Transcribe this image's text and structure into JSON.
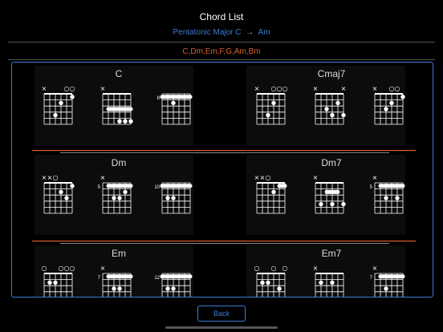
{
  "header": {
    "title": "Chord List",
    "key": "Pentatonic Major C",
    "arrow": "→",
    "relative": "Am"
  },
  "chord_list": "C,Dm,Em,F,G,Am,Bm",
  "back_label": "Back",
  "colors": {
    "accent": "#3a7bd5",
    "orange": "#d9622b",
    "grid": "#ffffff"
  },
  "groups": [
    {
      "label": "C",
      "diagrams": [
        {
          "open": [
            "x",
            "",
            "",
            "",
            "o",
            "o"
          ],
          "dots": [
            [
              2,
              4
            ],
            [
              3,
              2
            ],
            [
              5,
              1
            ]
          ],
          "barre": null,
          "fret": null
        },
        {
          "open": [
            "x",
            "",
            "",
            "",
            "",
            ""
          ],
          "dots": [
            [
              3,
              5
            ],
            [
              4,
              5
            ],
            [
              5,
              5
            ]
          ],
          "barre": [
            1,
            5,
            3
          ],
          "fret": null
        },
        {
          "open": [
            "",
            "",
            "",
            "",
            "",
            ""
          ],
          "dots": [
            [
              2,
              2
            ]
          ],
          "barre": [
            0,
            5,
            1
          ],
          "fret": "8"
        }
      ]
    },
    {
      "label": "Cmaj7",
      "diagrams": [
        {
          "open": [
            "x",
            "",
            "",
            "o",
            "o",
            "o"
          ],
          "dots": [
            [
              2,
              4
            ],
            [
              3,
              2
            ]
          ],
          "barre": null,
          "fret": null
        },
        {
          "open": [
            "x",
            "",
            "",
            "",
            "",
            "x"
          ],
          "dots": [
            [
              2,
              3
            ],
            [
              3,
              4
            ],
            [
              4,
              2
            ],
            [
              5,
              4
            ]
          ],
          "barre": null,
          "fret": null
        },
        {
          "open": [
            "x",
            "",
            "",
            "o",
            "o",
            ""
          ],
          "dots": [
            [
              2,
              3
            ],
            [
              3,
              2
            ],
            [
              5,
              1
            ]
          ],
          "barre": null,
          "fret": null
        }
      ]
    },
    {
      "label": "Dm",
      "diagrams": [
        {
          "open": [
            "x",
            "x",
            "o",
            "",
            "",
            ""
          ],
          "dots": [
            [
              4,
              3
            ],
            [
              5,
              1
            ],
            [
              3,
              2
            ]
          ],
          "barre": null,
          "fret": null
        },
        {
          "open": [
            "x",
            "",
            "",
            "",
            "",
            ""
          ],
          "dots": [
            [
              2,
              3
            ],
            [
              3,
              3
            ],
            [
              4,
              2
            ]
          ],
          "barre": [
            1,
            5,
            1
          ],
          "fret": "5"
        },
        {
          "open": [
            "",
            "",
            "",
            "",
            "",
            ""
          ],
          "dots": [
            [
              1,
              3
            ],
            [
              2,
              3
            ]
          ],
          "barre": [
            0,
            5,
            1
          ],
          "fret": "10"
        }
      ]
    },
    {
      "label": "Dm7",
      "diagrams": [
        {
          "open": [
            "x",
            "x",
            "o",
            "",
            "",
            ""
          ],
          "dots": [
            [
              3,
              2
            ]
          ],
          "barre": [
            4,
            5,
            1
          ],
          "fret": null
        },
        {
          "open": [
            "x",
            "",
            "",
            "",
            "",
            ""
          ],
          "dots": [
            [
              1,
              4
            ],
            [
              3,
              4
            ],
            [
              5,
              4
            ]
          ],
          "barre": [
            2,
            4,
            2
          ],
          "fret": null
        },
        {
          "open": [
            "x",
            "",
            "",
            "",
            "",
            ""
          ],
          "dots": [
            [
              2,
              3
            ],
            [
              4,
              3
            ]
          ],
          "barre": [
            1,
            5,
            1
          ],
          "fret": "5"
        }
      ]
    },
    {
      "label": "Em",
      "diagrams": [
        {
          "open": [
            "o",
            "",
            "",
            "o",
            "o",
            "o"
          ],
          "dots": [
            [
              1,
              2
            ],
            [
              2,
              2
            ]
          ],
          "barre": null,
          "fret": null
        },
        {
          "open": [
            "x",
            "",
            "",
            "",
            "",
            ""
          ],
          "dots": [
            [
              2,
              3
            ],
            [
              3,
              3
            ]
          ],
          "barre": [
            1,
            5,
            1
          ],
          "fret": "7"
        },
        {
          "open": [
            "",
            "",
            "",
            "",
            "",
            ""
          ],
          "dots": [
            [
              1,
              3
            ],
            [
              2,
              3
            ]
          ],
          "barre": [
            0,
            5,
            1
          ],
          "fret": "12"
        }
      ]
    },
    {
      "label": "Em7",
      "diagrams": [
        {
          "open": [
            "o",
            "",
            "",
            "o",
            "",
            "o"
          ],
          "dots": [
            [
              1,
              2
            ],
            [
              2,
              2
            ],
            [
              4,
              3
            ]
          ],
          "barre": null,
          "fret": null
        },
        {
          "open": [
            "x",
            "",
            "",
            "",
            "",
            ""
          ],
          "dots": [
            [
              1,
              2
            ],
            [
              3,
              2
            ]
          ],
          "barre": null,
          "fret": null
        },
        {
          "open": [
            "x",
            "",
            "",
            "",
            "",
            ""
          ],
          "dots": [
            [
              2,
              3
            ]
          ],
          "barre": [
            1,
            5,
            1
          ],
          "fret": "7"
        }
      ]
    }
  ]
}
